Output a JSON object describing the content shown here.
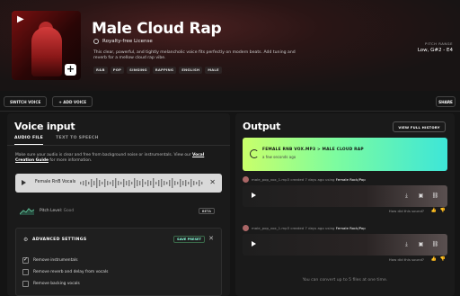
{
  "header": {
    "title": "Male Cloud Rap",
    "license": "Royalty-free License",
    "description": "This clear, powerful, and tightly melancholic voice fits perfectly on modern beats. Add tuning and reverb for a mellow cloud rap vibe.",
    "tags": [
      "R&B",
      "POP",
      "SINGING",
      "RAPPING",
      "ENGLISH",
      "MALE"
    ],
    "pitch_range_label": "PITCH RANGE",
    "pitch_range_value": "Low, G#2 - E4"
  },
  "actions": {
    "switch_voice": "SWITCH VOICE",
    "add_voice": "+ ADD VOICE",
    "share": "SHARE"
  },
  "voice_input": {
    "heading": "Voice input",
    "tabs": [
      "AUDIO FILE",
      "TEXT TO SPEECH"
    ],
    "help_text": "Make sure your audio is clear and free from background noise or instrumentals. View our ",
    "help_link": "Vocal Creation Guide",
    "help_tail": " for more information.",
    "voice_file": "Female RnB Vocals",
    "pitch_label": "Pitch Level:",
    "pitch_status": "Good",
    "beta": "BETA",
    "advanced_title": "ADVANCED SETTINGS",
    "save_preset": "SAVE PRESET",
    "options": [
      {
        "label": "Remove instrumentals",
        "checked": true
      },
      {
        "label": "Remove reverb and delay from vocals",
        "checked": false
      },
      {
        "label": "Remove backing vocals",
        "checked": false
      }
    ]
  },
  "output": {
    "heading": "Output",
    "history_button": "VIEW FULL HISTORY",
    "converting_title": "FEMALE RNB VOX.MP3 > MALE CLOUD RAP",
    "converting_time": "a few seconds ago",
    "results": [
      {
        "file": "male_pop_vox_1.mp3",
        "meta": " created 7 days ago using ",
        "voice": "Female Rock/Pop",
        "question": "How did this sound?"
      },
      {
        "file": "male_pop_vox_1.mp3",
        "meta": " created 7 days ago using ",
        "voice": "Female Rock/Pop",
        "question": "How did this sound?"
      }
    ],
    "footer": "You can convert up to 5 files at one time."
  }
}
